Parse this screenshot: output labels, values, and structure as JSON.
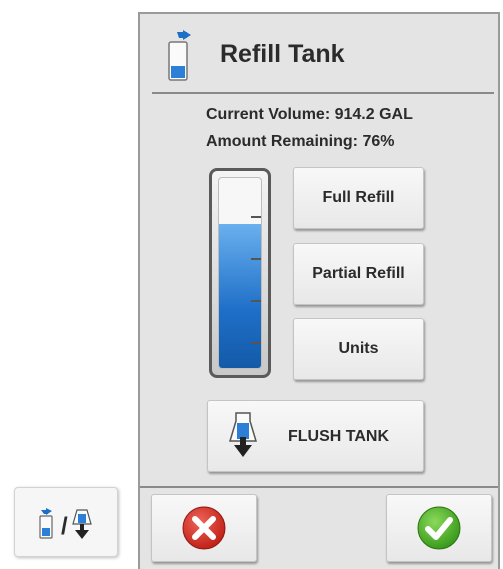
{
  "dialog": {
    "title": "Refill Tank",
    "header_icon": "tank-refill-icon",
    "current_volume": "Current Volume: 914.2 GAL",
    "amount_remaining": "Amount Remaining: 76%",
    "tank_fill_fraction": 0.76
  },
  "buttons": {
    "full_refill": "Full Refill",
    "partial_refill": "Partial Refill",
    "units": "Units",
    "flush_tank": "FLUSH TANK",
    "flush_icon": "flush-tank-icon",
    "cancel_icon": "cancel-x-icon",
    "confirm_icon": "confirm-check-icon"
  },
  "shortcut": {
    "icon": "refill-flush-icon",
    "separator": "/"
  },
  "colors": {
    "fill": "#1e6fc8",
    "cancel": "#d9352b",
    "confirm": "#4caf2a"
  }
}
